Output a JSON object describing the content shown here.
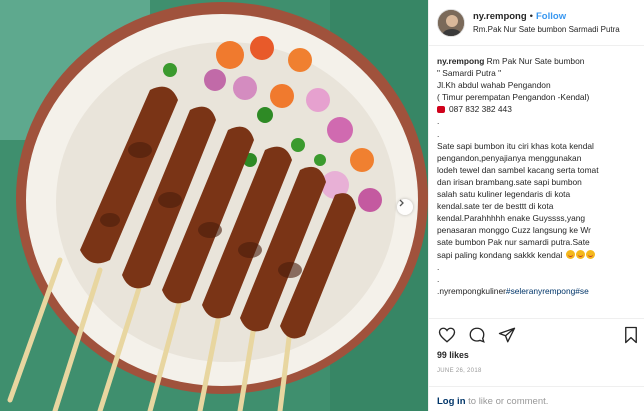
{
  "header": {
    "username": "ny.rempong",
    "separator": "•",
    "follow_label": "Follow",
    "location": "Rm.Pak Nur Sate bumbon Sarmadi Putra"
  },
  "caption": {
    "lines": [
      {
        "user": "ny.rempong",
        "text": " Rm Pak Nur Sate bumbon"
      },
      {
        "text": "\" Samardi Putra \""
      },
      {
        "text": "Jl.Kh abdul wahab Pengandon"
      },
      {
        "text": "( Timur perempatan Pengandon -Kendal)"
      },
      {
        "text": "087 832 382 443",
        "icon": "phone-icon"
      },
      {
        "text": "."
      },
      {
        "text": "."
      },
      {
        "text": "Sate sapi bumbon itu ciri khas kota kendal"
      },
      {
        "text": "pengandon,penyajianya menggunakan"
      },
      {
        "text": "lodeh tewel dan sambel kacang serta tomat"
      },
      {
        "text": "dan irisan brambang.sate sapi bumbon"
      },
      {
        "text": "salah satu kuliner legendaris di kota"
      },
      {
        "text": "kendal.sate ter de besttt di kota"
      },
      {
        "text": "kendal.Parahhhhh enake Guyssss,yang"
      },
      {
        "text": "penasaran monggo Cuzz langsung ke Wr"
      },
      {
        "text": "sate bumbon Pak nur samardi putra.Sate"
      },
      {
        "text": "sapi paling kondang sakkk kendal",
        "emoji_count": 3
      },
      {
        "text": "."
      },
      {
        "text": "."
      },
      {
        "text": ".nyrempongkuliner",
        "tags": "#seleranyrempong#se"
      }
    ]
  },
  "actions": {
    "icons": [
      "heart-icon",
      "comment-icon",
      "share-icon",
      "bookmark-icon"
    ]
  },
  "likes": "99 likes",
  "date": "JUNE 26, 2018",
  "login_prompt": {
    "login_label": "Log in",
    "rest": " to like or comment."
  },
  "colors": {
    "link_blue": "#3897f0",
    "hashtag": "#003569",
    "text": "#262626",
    "muted": "#999999",
    "photo_background": "#3f8f6e"
  }
}
